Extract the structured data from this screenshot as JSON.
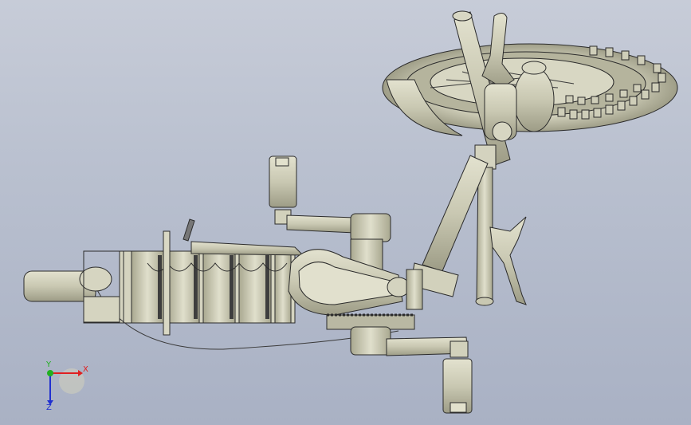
{
  "viewport": {
    "background_top": "#c7ccd8",
    "background_bottom": "#a9b1c4",
    "part_color": "#c9c8b2",
    "part_shade": "#a9a890",
    "edge_color": "#2b2b2b"
  },
  "triad": {
    "x_label": "X",
    "y_label": "Y",
    "z_label": "Z",
    "x_color": "#e02020",
    "y_color": "#20b020",
    "z_color": "#2030d0"
  }
}
